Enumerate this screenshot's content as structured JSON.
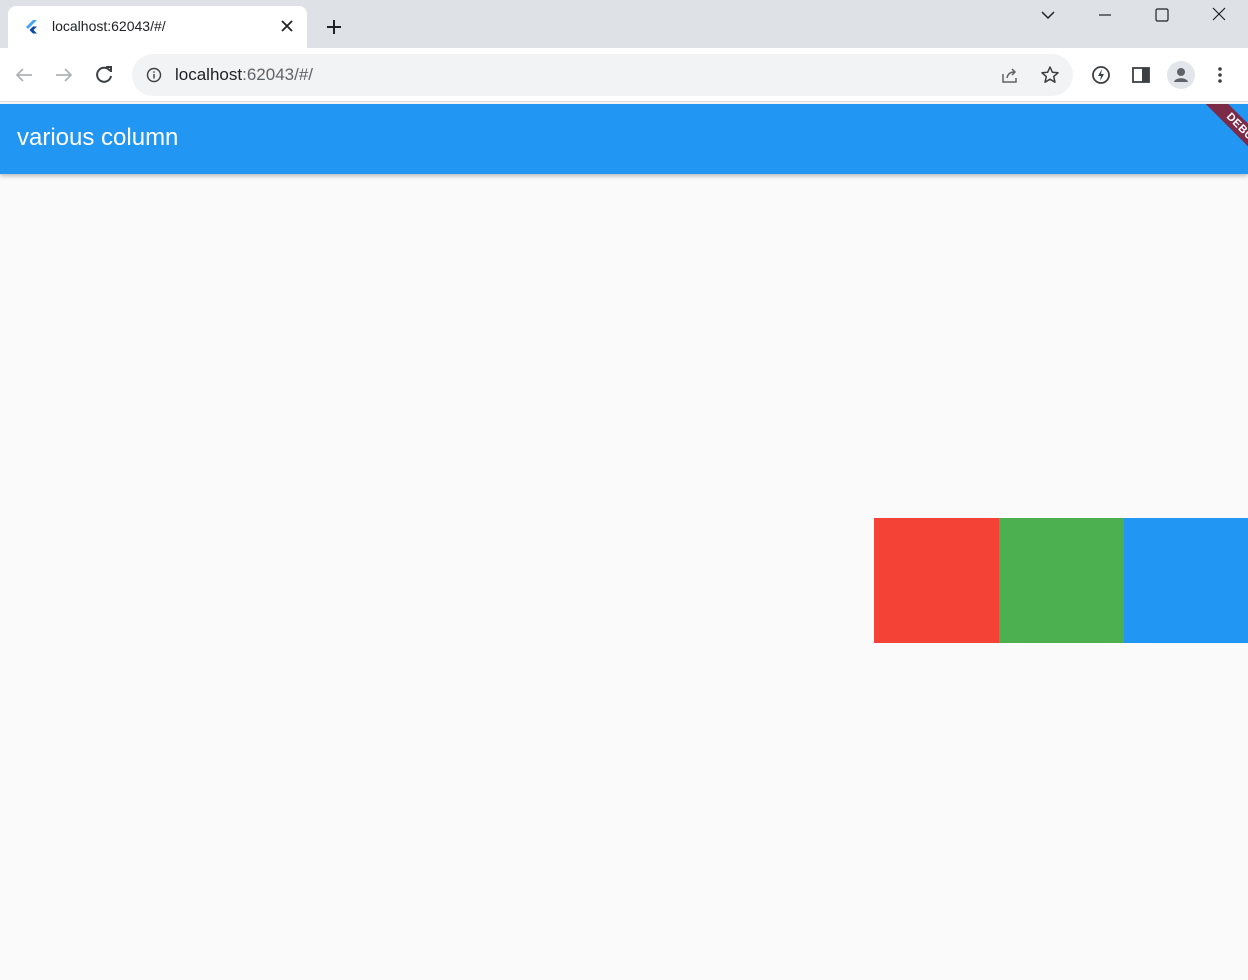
{
  "browser": {
    "tab": {
      "title": "localhost:62043/#/"
    },
    "omnibox": {
      "host": "localhost",
      "path": ":62043/#/"
    }
  },
  "app": {
    "title": "various column",
    "debug_banner": "DEBUG",
    "boxes": [
      {
        "color": "#f44336"
      },
      {
        "color": "#4caf50"
      },
      {
        "color": "#2196f3"
      }
    ]
  },
  "colors": {
    "app_bar": "#2196f3",
    "background": "#fafafa",
    "debug_banner": "#7b2a48"
  }
}
